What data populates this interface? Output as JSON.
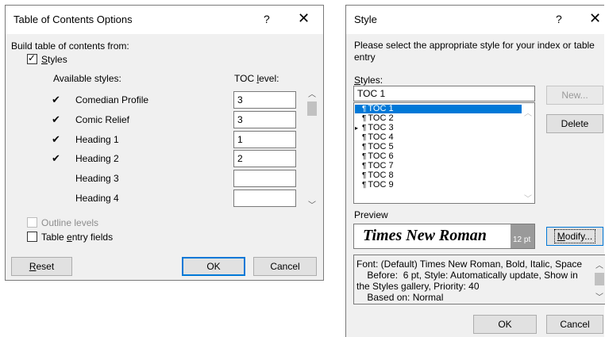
{
  "toc_dialog": {
    "title": "Table of Contents Options",
    "help_label": "?",
    "close_label": "✕",
    "build_from_label": "Build table of contents from:",
    "styles_checkbox": {
      "label_first": "S",
      "label_rest": "tyles",
      "checked": true
    },
    "available_styles_header": "Available styles:",
    "toc_level_header_pre": "TOC ",
    "toc_level_header_accel": "l",
    "toc_level_header_post": "evel:",
    "rows": [
      {
        "check": "✔",
        "name": "Comedian Profile",
        "level": "3"
      },
      {
        "check": "✔",
        "name": "Comic Relief",
        "level": "3"
      },
      {
        "check": "✔",
        "name": "Heading 1",
        "level": "1"
      },
      {
        "check": "✔",
        "name": "Heading 2",
        "level": "2"
      },
      {
        "check": "",
        "name": "Heading 3",
        "level": ""
      },
      {
        "check": "",
        "name": "Heading 4",
        "level": ""
      }
    ],
    "outline_levels_label": "Outline levels",
    "table_entry_pre": "Table ",
    "table_entry_accel": "e",
    "table_entry_post": "ntry fields",
    "reset_accel": "R",
    "reset_rest": "eset",
    "ok_label": "OK",
    "cancel_label": "Cancel"
  },
  "style_dialog": {
    "title": "Style",
    "help_label": "?",
    "close_label": "✕",
    "instruction_line1": "Please select the appropriate style for your index or table",
    "instruction_line2": "entry",
    "styles_label_accel": "S",
    "styles_label_rest": "tyles:",
    "style_input_value": "TOC 1",
    "style_list": [
      "TOC 1",
      "TOC 2",
      "TOC 3",
      "TOC 4",
      "TOC 5",
      "TOC 6",
      "TOC 7",
      "TOC 8",
      "TOC 9"
    ],
    "selected_index": 0,
    "pilcrow": "¶",
    "new_label": "New...",
    "delete_label": "Delete",
    "preview_label": "Preview",
    "preview_font_name": "Times New Roman",
    "preview_size": "12 pt",
    "modify_accel": "M",
    "modify_rest": "odify...",
    "description_lines": [
      "Font: (Default) Times New Roman, Bold, Italic, Space",
      "    Before:  6 pt, Style: Automatically update, Show in",
      "the Styles gallery, Priority: 40",
      "    Based on: Normal"
    ],
    "ok_label": "OK",
    "cancel_label": "Cancel"
  },
  "icons": [
    "check-icon",
    "pilcrow-icon",
    "expand-arrow-icon",
    "scroll-up-icon",
    "scroll-down-icon",
    "help-icon",
    "close-icon"
  ],
  "colors": {
    "selection": "#0078d7",
    "dialog_bg": "#f0f0f0",
    "title_bg": "#ffffff"
  }
}
